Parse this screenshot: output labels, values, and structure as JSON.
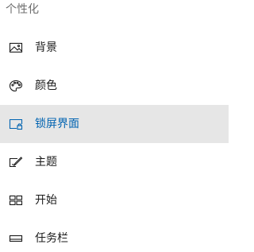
{
  "section": {
    "title": "个性化"
  },
  "nav": {
    "items": [
      {
        "id": "background",
        "label": "背景",
        "icon": "picture-icon",
        "selected": false
      },
      {
        "id": "colors",
        "label": "颜色",
        "icon": "palette-icon",
        "selected": false
      },
      {
        "id": "lockscreen",
        "label": "锁屏界面",
        "icon": "lockscreen-icon",
        "selected": true
      },
      {
        "id": "themes",
        "label": "主题",
        "icon": "brush-icon",
        "selected": false
      },
      {
        "id": "start",
        "label": "开始",
        "icon": "start-tiles-icon",
        "selected": false
      },
      {
        "id": "taskbar",
        "label": "任务栏",
        "icon": "taskbar-icon",
        "selected": false
      }
    ]
  },
  "colors": {
    "accent": "#0063b1",
    "selected_bg": "#e6e6e6",
    "text": "#1a1a1a",
    "muted": "#6d6d6d"
  }
}
